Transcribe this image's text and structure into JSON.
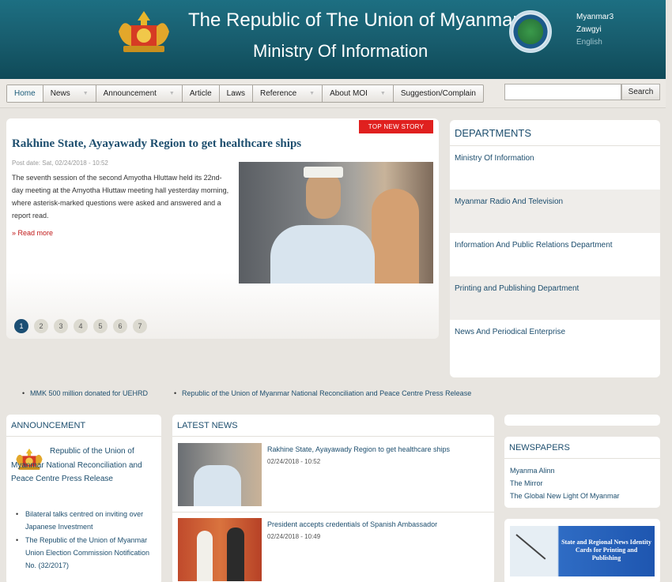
{
  "header": {
    "title_line1": "The Republic of The Union of Myanmar",
    "title_line2": "Ministry Of Information",
    "languages": [
      "Myanmar3",
      "Zawgyi",
      "English"
    ]
  },
  "nav": {
    "items": [
      "Home",
      "News",
      "Announcement",
      "Article",
      "Laws",
      "Reference",
      "About MOI",
      "Suggestion/Complain"
    ],
    "search_button": "Search",
    "search_placeholder": ""
  },
  "top_story": {
    "badge": "TOP NEW STORY",
    "title": "Rakhine State, Ayayawady Region to get healthcare ships",
    "date": "Post date: Sat, 02/24/2018 - 10:52",
    "text": "The seventh session of the second Amyotha Hluttaw held its 22nd-day meeting at the Amyotha Hluttaw meeting hall yesterday morning, where asterisk-marked questions were asked and answered and a report read.",
    "read_more": "Read more",
    "pages": [
      "1",
      "2",
      "3",
      "4",
      "5",
      "6",
      "7"
    ],
    "current_page": "1"
  },
  "departments": {
    "heading": "DEPARTMENTS",
    "items": [
      "Ministry Of Information",
      "Myanmar Radio And Television",
      "Information And Public Relations Department",
      "Printing and Publishing Department",
      "News And Periodical Enterprise"
    ]
  },
  "ticker": [
    "MMK 500 million donated for UEHRD",
    "Republic of the Union of Myanmar National Reconciliation and Peace Centre Press Release"
  ],
  "announcement": {
    "heading": "ANNOUNCEMENT",
    "lead": "Republic of the Union of Myanmar National Reconciliation and Peace Centre Press Release",
    "items": [
      "Bilateral talks centred on inviting over Japanese Investment",
      "The Republic of the Union of Myanmar Union Election Commission Notification No. (32/2017)"
    ]
  },
  "latest_news": {
    "heading": "LATEST NEWS",
    "items": [
      {
        "title": "Rakhine State, Ayayawady Region to get healthcare ships",
        "date": "02/24/2018 - 10:52"
      },
      {
        "title": "President accepts credentials of Spanish Ambassador",
        "date": "02/24/2018 - 10:49"
      }
    ]
  },
  "newspapers": {
    "heading": "NEWSPAPERS",
    "items": [
      "Myanma Alinn",
      "The Mirror",
      "The Global New Light Of Myanmar"
    ]
  },
  "banner": {
    "text": "State and Regional News Identity Cards for Printing and Publishing"
  },
  "colors": {
    "header_bg": "#185d6e",
    "link": "#1d4e6e",
    "badge": "#e0201f",
    "page_active": "#1c4f74"
  }
}
